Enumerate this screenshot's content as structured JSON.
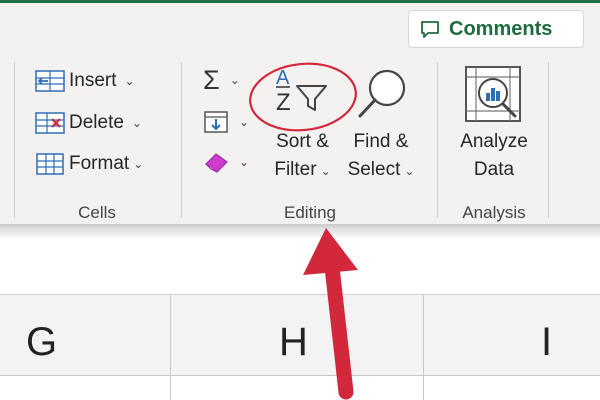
{
  "comments": {
    "label": "Comments"
  },
  "cells_group": {
    "label": "Cells",
    "items": [
      {
        "label": "Insert"
      },
      {
        "label": "Delete"
      },
      {
        "label": "Format"
      }
    ]
  },
  "editing_group": {
    "label": "Editing",
    "sort_filter": {
      "line1": "Sort &",
      "line2": "Filter"
    },
    "find_select": {
      "line1": "Find &",
      "line2": "Select"
    }
  },
  "analysis_group": {
    "label": "Analysis",
    "analyze": {
      "line1": "Analyze",
      "line2": "Data"
    }
  },
  "columns": [
    "G",
    "H",
    "I"
  ],
  "colors": {
    "accent_green": "#1e6b3f",
    "annotation_red": "#d3283c",
    "ribbon_bg": "#f3f2f1"
  },
  "icons": [
    "comment-icon",
    "insert-cells-icon",
    "delete-cells-icon",
    "format-cells-icon",
    "autosum-icon",
    "fill-icon",
    "clear-icon",
    "sort-filter-icon",
    "find-select-icon",
    "analyze-data-icon"
  ]
}
